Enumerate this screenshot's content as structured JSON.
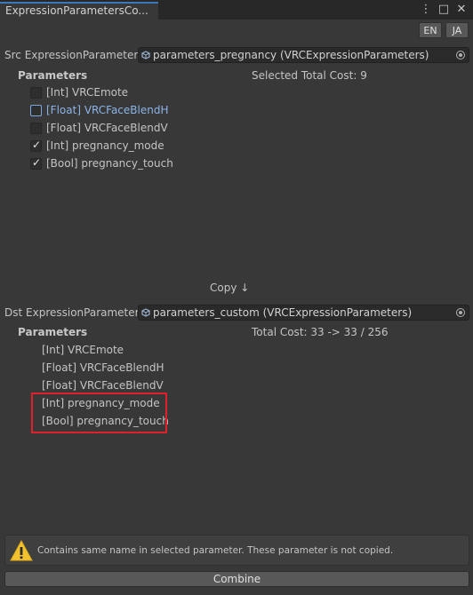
{
  "window": {
    "tab_title": "ExpressionParametersCo...",
    "menu_icon": "kebab-menu-icon",
    "close_icon": "close-icon"
  },
  "language": {
    "en": "EN",
    "ja": "JA"
  },
  "src": {
    "label": "Src ExpressionParameters",
    "object_value": "parameters_pregnancy (VRCExpressionParameters)",
    "section_title": "Parameters",
    "cost_text": "Selected Total Cost: 9",
    "items": [
      {
        "label": "[Int] VRCEmote",
        "checked": false
      },
      {
        "label": "[Float] VRCFaceBlendH",
        "checked": false,
        "focused": true
      },
      {
        "label": "[Float] VRCFaceBlendV",
        "checked": false
      },
      {
        "label": "[Int] pregnancy_mode",
        "checked": true
      },
      {
        "label": "[Bool] pregnancy_touch",
        "checked": true
      }
    ]
  },
  "copy_label": "Copy ↓",
  "dst": {
    "label": "Dst ExpressionParameters",
    "object_value": "parameters_custom (VRCExpressionParameters)",
    "section_title": "Parameters",
    "cost_text": "Total Cost: 33 -> 33 / 256",
    "items": [
      "[Int] VRCEmote",
      "[Float] VRCFaceBlendH",
      "[Float] VRCFaceBlendV",
      "[Int] pregnancy_mode",
      "[Bool] pregnancy_touch"
    ]
  },
  "warning": {
    "icon": "warning-icon",
    "text": "Contains same name in selected parameter. These parameter is not copied."
  },
  "combine_label": "Combine",
  "colors": {
    "highlight_box": "#e0202a",
    "focus_text": "#8cb3e8",
    "tab_accent": "#3a79bb"
  }
}
